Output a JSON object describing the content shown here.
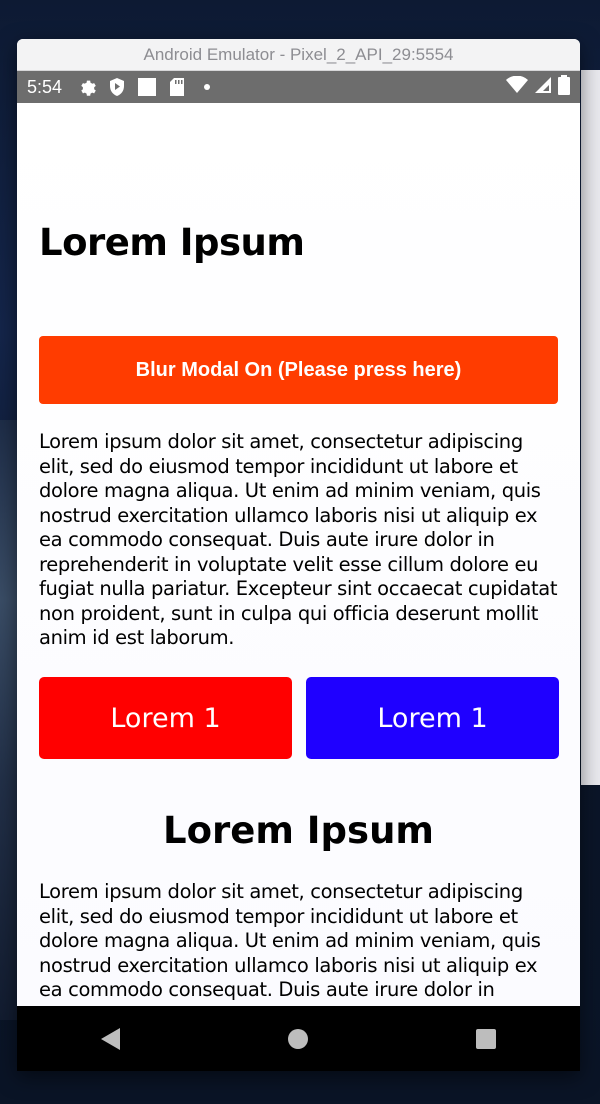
{
  "window": {
    "title": "Android Emulator - Pixel_2_API_29:5554"
  },
  "status": {
    "time": "5:54"
  },
  "screen": {
    "heading": "Lorem Ipsum",
    "blur_button": "Blur Modal On (Please press here)",
    "paragraph1": "Lorem ipsum dolor sit amet, consectetur adipiscing elit, sed do eiusmod tempor incididunt ut labore et dolore magna aliqua. Ut enim ad minim veniam, quis nostrud exercitation ullamco laboris nisi ut aliquip ex ea commodo consequat. Duis aute irure dolor in reprehenderit in voluptate velit esse cillum dolore eu fugiat nulla pariatur. Excepteur sint occaecat cupidatat non proident, sunt in culpa qui officia deserunt mollit anim id est laborum.",
    "button_left": "Lorem 1",
    "button_right": "Lorem 1",
    "heading2": "Lorem Ipsum",
    "paragraph2": "Lorem ipsum dolor sit amet, consectetur adipiscing elit, sed do eiusmod tempor incididunt ut labore et dolore magna aliqua. Ut enim ad minim veniam, quis nostrud exercitation ullamco laboris nisi ut aliquip ex ea commodo consequat. Duis aute irure dolor in"
  },
  "colors": {
    "blur_button": "#ff3c00",
    "button_left": "#ff0000",
    "button_right": "#1f00ff"
  },
  "icons": {
    "status_left": [
      "gear-icon",
      "shield-icon",
      "square-icon",
      "sd-card-icon",
      "dot-icon"
    ],
    "status_right": [
      "wifi-icon",
      "cell-signal-icon",
      "battery-icon"
    ],
    "nav": [
      "back-icon",
      "home-icon",
      "recents-icon"
    ]
  }
}
